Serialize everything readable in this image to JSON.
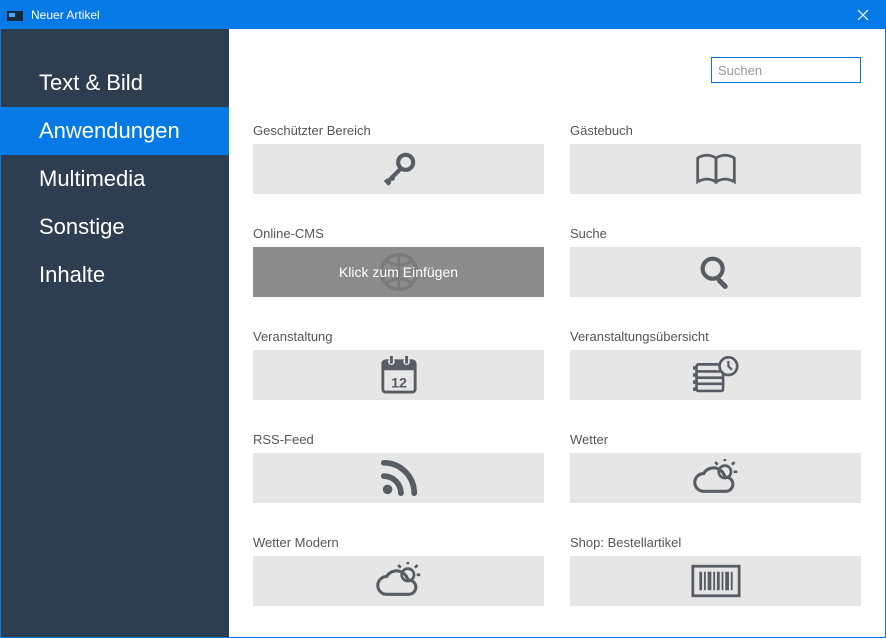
{
  "window": {
    "title": "Neuer Artikel"
  },
  "search": {
    "placeholder": "Suchen"
  },
  "sidebar": {
    "items": [
      {
        "label": "Text & Bild"
      },
      {
        "label": "Anwendungen"
      },
      {
        "label": "Multimedia"
      },
      {
        "label": "Sonstige"
      },
      {
        "label": "Inhalte"
      }
    ],
    "activeIndex": 1
  },
  "hoverText": "Klick zum Einfügen",
  "tiles": [
    {
      "label": "Geschützter Bereich",
      "icon": "key-icon"
    },
    {
      "label": "Gästebuch",
      "icon": "book-icon"
    },
    {
      "label": "Online-CMS",
      "icon": "globe-icon",
      "hovered": true
    },
    {
      "label": "Suche",
      "icon": "search-icon"
    },
    {
      "label": "Veranstaltung",
      "icon": "calendar-icon"
    },
    {
      "label": "Veranstaltungsübersicht",
      "icon": "schedule-icon"
    },
    {
      "label": "RSS-Feed",
      "icon": "rss-icon"
    },
    {
      "label": "Wetter",
      "icon": "weather-icon"
    },
    {
      "label": "Wetter Modern",
      "icon": "weather-icon"
    },
    {
      "label": "Shop: Bestellartikel",
      "icon": "barcode-icon"
    }
  ]
}
